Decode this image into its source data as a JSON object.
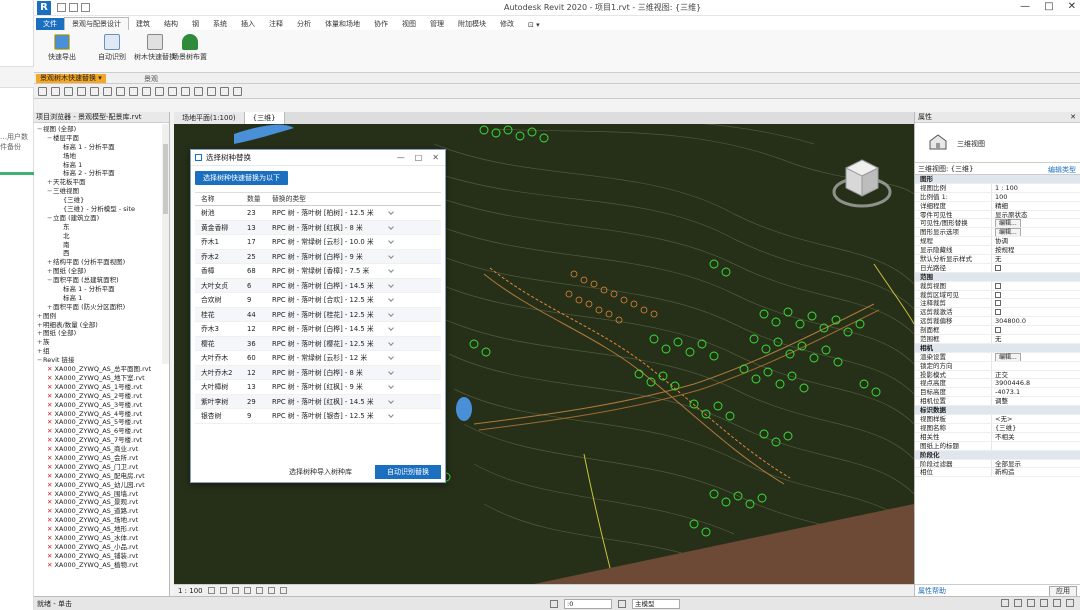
{
  "window": {
    "title": "Autodesk Revit 2020 - 项目1.rvt - 三维视图: {三维}",
    "controls": [
      "—",
      "□",
      "✕"
    ]
  },
  "left_strip": {
    "text": [
      "…用户数",
      "件备份"
    ]
  },
  "ribbon": {
    "file_tab": "文件",
    "tabs": [
      "景观与配景设计",
      "建筑",
      "结构",
      "钢",
      "系统",
      "插入",
      "注释",
      "分析",
      "体量和场地",
      "协作",
      "视图",
      "管理",
      "附加模块",
      "修改",
      "⊡ ▾"
    ],
    "active_tab_index": 0,
    "buttons": [
      "快速导出",
      "自动识别",
      "树木快速替换",
      "场景树布置"
    ],
    "context_label": "景观树木快速替换 ▾",
    "group_label": "景观"
  },
  "project_browser": {
    "title": "项目浏览器 - 景观模型-配景库.rvt",
    "items": [
      {
        "t": "视图 (全部)",
        "lvl": 0,
        "tog": "−"
      },
      {
        "t": "楼层平面",
        "lvl": 1,
        "tog": "−"
      },
      {
        "t": "标高 1 - 分析平面",
        "lvl": 2,
        "tog": ""
      },
      {
        "t": "场地",
        "lvl": 2,
        "tog": ""
      },
      {
        "t": "标高 1",
        "lvl": 2,
        "tog": ""
      },
      {
        "t": "标高 2 - 分析平面",
        "lvl": 2,
        "tog": ""
      },
      {
        "t": "天花板平面",
        "lvl": 1,
        "tog": "+"
      },
      {
        "t": "三维视图",
        "lvl": 1,
        "tog": "−"
      },
      {
        "t": "{三维}",
        "lvl": 2,
        "tog": ""
      },
      {
        "t": "{三维} - 分析模型 - site",
        "lvl": 2,
        "tog": ""
      },
      {
        "t": "立面 (建筑立面)",
        "lvl": 1,
        "tog": "−"
      },
      {
        "t": "东",
        "lvl": 2,
        "tog": ""
      },
      {
        "t": "北",
        "lvl": 2,
        "tog": ""
      },
      {
        "t": "南",
        "lvl": 2,
        "tog": ""
      },
      {
        "t": "西",
        "lvl": 2,
        "tog": ""
      },
      {
        "t": "结构平面 (分析平面视图)",
        "lvl": 1,
        "tog": "+"
      },
      {
        "t": "图纸 (全部)",
        "lvl": 1,
        "tog": "+"
      },
      {
        "t": "面积平面 (总建筑面积)",
        "lvl": 1,
        "tog": "−"
      },
      {
        "t": "标高 1 - 分析平面",
        "lvl": 2,
        "tog": ""
      },
      {
        "t": "标高 1",
        "lvl": 2,
        "tog": ""
      },
      {
        "t": "面积平面 (防火分区面积)",
        "lvl": 1,
        "tog": "+"
      },
      {
        "t": "图例",
        "lvl": 0,
        "tog": "+"
      },
      {
        "t": "明细表/数量 (全部)",
        "lvl": 0,
        "tog": "+"
      },
      {
        "t": "图纸 (全部)",
        "lvl": 0,
        "tog": "+"
      },
      {
        "t": "族",
        "lvl": 0,
        "tog": "+"
      },
      {
        "t": "组",
        "lvl": 0,
        "tog": "+"
      },
      {
        "t": "Revit 链接",
        "lvl": 0,
        "tog": "−"
      },
      {
        "t": "XA000_ZYWQ_AS_总平面图.rvt",
        "lvl": 1,
        "tog": "x"
      },
      {
        "t": "XA000_ZYWQ_AS_地下室.rvt",
        "lvl": 1,
        "tog": "x"
      },
      {
        "t": "XA000_ZYWQ_AS_1号楼.rvt",
        "lvl": 1,
        "tog": "x"
      },
      {
        "t": "XA000_ZYWQ_AS_2号楼.rvt",
        "lvl": 1,
        "tog": "x"
      },
      {
        "t": "XA000_ZYWQ_AS_3号楼.rvt",
        "lvl": 1,
        "tog": "x"
      },
      {
        "t": "XA000_ZYWQ_AS_4号楼.rvt",
        "lvl": 1,
        "tog": "x"
      },
      {
        "t": "XA000_ZYWQ_AS_5号楼.rvt",
        "lvl": 1,
        "tog": "x"
      },
      {
        "t": "XA000_ZYWQ_AS_6号楼.rvt",
        "lvl": 1,
        "tog": "x"
      },
      {
        "t": "XA000_ZYWQ_AS_7号楼.rvt",
        "lvl": 1,
        "tog": "x"
      },
      {
        "t": "XA000_ZYWQ_AS_商业.rvt",
        "lvl": 1,
        "tog": "x"
      },
      {
        "t": "XA000_ZYWQ_AS_会所.rvt",
        "lvl": 1,
        "tog": "x"
      },
      {
        "t": "XA000_ZYWQ_AS_门卫.rvt",
        "lvl": 1,
        "tog": "x"
      },
      {
        "t": "XA000_ZYWQ_AS_配电房.rvt",
        "lvl": 1,
        "tog": "x"
      },
      {
        "t": "XA000_ZYWQ_AS_幼儿园.rvt",
        "lvl": 1,
        "tog": "x"
      },
      {
        "t": "XA000_ZYWQ_AS_围墙.rvt",
        "lvl": 1,
        "tog": "x"
      },
      {
        "t": "XA000_ZYWQ_AS_景观.rvt",
        "lvl": 1,
        "tog": "x"
      },
      {
        "t": "XA000_ZYWQ_AS_道路.rvt",
        "lvl": 1,
        "tog": "x"
      },
      {
        "t": "XA000_ZYWQ_AS_场地.rvt",
        "lvl": 1,
        "tog": "x"
      },
      {
        "t": "XA000_ZYWQ_AS_地形.rvt",
        "lvl": 1,
        "tog": "x"
      },
      {
        "t": "XA000_ZYWQ_AS_水体.rvt",
        "lvl": 1,
        "tog": "x"
      },
      {
        "t": "XA000_ZYWQ_AS_小品.rvt",
        "lvl": 1,
        "tog": "x"
      },
      {
        "t": "XA000_ZYWQ_AS_铺装.rvt",
        "lvl": 1,
        "tog": "x"
      },
      {
        "t": "XA000_ZYWQ_AS_植物.rvt",
        "lvl": 1,
        "tog": "x"
      }
    ]
  },
  "view_tabs": [
    "场地平面(1:100)",
    "{三维}"
  ],
  "view_status": {
    "scale": "1 : 100"
  },
  "dialog": {
    "title": "选择树种替换",
    "top_button": "选择树种快速替换为以下",
    "columns": [
      "名称",
      "数量",
      "替换的类型"
    ],
    "rows": [
      {
        "name": "树池",
        "count": "23",
        "type": "RPC 树 - 落叶树 [柏树] - 12.5 米"
      },
      {
        "name": "黄金香柳",
        "count": "13",
        "type": "RPC 树 - 落叶树 [红枫] - 8 米"
      },
      {
        "name": "乔木1",
        "count": "17",
        "type": "RPC 树 - 常绿树 [云杉] - 10.0 米"
      },
      {
        "name": "乔木2",
        "count": "25",
        "type": "RPC 树 - 落叶树 [白桦] - 9 米"
      },
      {
        "name": "香樟",
        "count": "68",
        "type": "RPC 树 - 常绿树 [香樟] - 7.5 米"
      },
      {
        "name": "大叶女贞",
        "count": "6",
        "type": "RPC 树 - 落叶树 [白桦] - 14.5 米"
      },
      {
        "name": "合欢树",
        "count": "9",
        "type": "RPC 树 - 落叶树 [合欢] - 12.5 米"
      },
      {
        "name": "桂花",
        "count": "44",
        "type": "RPC 树 - 落叶树 [桂花] - 12.5 米"
      },
      {
        "name": "乔木3",
        "count": "12",
        "type": "RPC 树 - 落叶树 [白桦] - 14.5 米"
      },
      {
        "name": "樱花",
        "count": "36",
        "type": "RPC 树 - 落叶树 [樱花] - 12.5 米"
      },
      {
        "name": "大叶乔木",
        "count": "60",
        "type": "RPC 树 - 常绿树 [云杉] - 12 米"
      },
      {
        "name": "大叶乔木2",
        "count": "12",
        "type": "RPC 树 - 落叶树 [白桦] - 8 米"
      },
      {
        "name": "大叶樟树",
        "count": "13",
        "type": "RPC 树 - 落叶树 [红枫] - 9 米"
      },
      {
        "name": "紫叶李树",
        "count": "29",
        "type": "RPC 树 - 落叶树 [红枫] - 14.5 米"
      },
      {
        "name": "银杏树",
        "count": "9",
        "type": "RPC 树 - 落叶树 [银杏] - 12.5 米"
      }
    ],
    "link_button": "选择树种导入树种库",
    "ok_button": "自动识别替换",
    "controls": [
      "—",
      "□",
      "✕"
    ]
  },
  "properties": {
    "title": "属性",
    "type_name": "三维视图",
    "selector": "三维视图: {三维}",
    "edit_type": "编辑类型",
    "rows": [
      {
        "k": "图形",
        "v": "",
        "cat": true
      },
      {
        "k": "视图比例",
        "v": "1 : 100"
      },
      {
        "k": "比例值 1:",
        "v": "100"
      },
      {
        "k": "详细程度",
        "v": "精细"
      },
      {
        "k": "零件可见性",
        "v": "显示原状态"
      },
      {
        "k": "可见性/图形替换",
        "v": "编辑...",
        "btn": true
      },
      {
        "k": "图形显示选项",
        "v": "编辑...",
        "btn": true
      },
      {
        "k": "规程",
        "v": "协调"
      },
      {
        "k": "显示隐藏线",
        "v": "按规程"
      },
      {
        "k": "默认分析显示样式",
        "v": "无"
      },
      {
        "k": "日光路径",
        "v": "",
        "chk": false
      },
      {
        "k": "范围",
        "v": "",
        "cat": true
      },
      {
        "k": "裁剪视图",
        "v": "",
        "chk": false
      },
      {
        "k": "裁剪区域可见",
        "v": "",
        "chk": false
      },
      {
        "k": "注释裁剪",
        "v": "",
        "chk": false
      },
      {
        "k": "远剪裁激活",
        "v": "",
        "chk": false
      },
      {
        "k": "远剪裁偏移",
        "v": "304800.0"
      },
      {
        "k": "剖面框",
        "v": "",
        "chk": false
      },
      {
        "k": "范围框",
        "v": "无"
      },
      {
        "k": "相机",
        "v": "",
        "cat": true
      },
      {
        "k": "渲染设置",
        "v": "编辑...",
        "btn": true
      },
      {
        "k": "锁定的方向",
        "v": ""
      },
      {
        "k": "投影模式",
        "v": "正交"
      },
      {
        "k": "视点高度",
        "v": "3900446.8"
      },
      {
        "k": "目标高度",
        "v": "-4073.1"
      },
      {
        "k": "相机位置",
        "v": "调整"
      },
      {
        "k": "标识数据",
        "v": "",
        "cat": true
      },
      {
        "k": "视图样板",
        "v": "<无>"
      },
      {
        "k": "视图名称",
        "v": "{三维}"
      },
      {
        "k": "相关性",
        "v": "不相关"
      },
      {
        "k": "图纸上的标题",
        "v": ""
      },
      {
        "k": "阶段化",
        "v": "",
        "cat": true
      },
      {
        "k": "阶段过滤器",
        "v": "全部显示"
      },
      {
        "k": "相位",
        "v": "新构造"
      }
    ],
    "help_link": "属性帮助",
    "apply": "应用"
  },
  "statusbar": {
    "left": "就绪 - 单击",
    "scale_field": ":0",
    "filter_field": "主模型"
  },
  "colors": {
    "accent": "#1c6fbf",
    "terrain": "#263019",
    "tree_green": "#39e639",
    "tree_orange": "#e0873a",
    "water": "#4a90d9"
  }
}
